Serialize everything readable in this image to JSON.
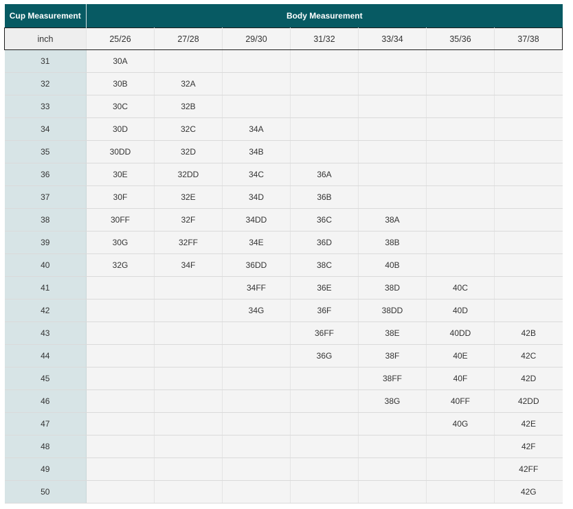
{
  "header": {
    "cup_measurement": "Cup Measurement",
    "body_measurement": "Body Measurement"
  },
  "subheader": {
    "unit": "inch",
    "body_sizes": [
      "25/26",
      "27/28",
      "29/30",
      "31/32",
      "33/34",
      "35/36",
      "37/38"
    ]
  },
  "rows": [
    {
      "cup": "31",
      "sizes": [
        "30A",
        "",
        "",
        "",
        "",
        "",
        ""
      ]
    },
    {
      "cup": "32",
      "sizes": [
        "30B",
        "32A",
        "",
        "",
        "",
        "",
        ""
      ]
    },
    {
      "cup": "33",
      "sizes": [
        "30C",
        "32B",
        "",
        "",
        "",
        "",
        ""
      ]
    },
    {
      "cup": "34",
      "sizes": [
        "30D",
        "32C",
        "34A",
        "",
        "",
        "",
        ""
      ]
    },
    {
      "cup": "35",
      "sizes": [
        "30DD",
        "32D",
        "34B",
        "",
        "",
        "",
        ""
      ]
    },
    {
      "cup": "36",
      "sizes": [
        "30E",
        "32DD",
        "34C",
        "36A",
        "",
        "",
        ""
      ]
    },
    {
      "cup": "37",
      "sizes": [
        "30F",
        "32E",
        "34D",
        "36B",
        "",
        "",
        ""
      ]
    },
    {
      "cup": "38",
      "sizes": [
        "30FF",
        "32F",
        "34DD",
        "36C",
        "38A",
        "",
        ""
      ]
    },
    {
      "cup": "39",
      "sizes": [
        "30G",
        "32FF",
        "34E",
        "36D",
        "38B",
        "",
        ""
      ]
    },
    {
      "cup": "40",
      "sizes": [
        "32G",
        "34F",
        "36DD",
        "38C",
        "40B",
        "",
        ""
      ]
    },
    {
      "cup": "41",
      "sizes": [
        "",
        "",
        "34FF",
        "36E",
        "38D",
        "40C",
        ""
      ]
    },
    {
      "cup": "42",
      "sizes": [
        "",
        "",
        "34G",
        "36F",
        "38DD",
        "40D",
        ""
      ]
    },
    {
      "cup": "43",
      "sizes": [
        "",
        "",
        "",
        "36FF",
        "38E",
        "40DD",
        "42B"
      ]
    },
    {
      "cup": "44",
      "sizes": [
        "",
        "",
        "",
        "36G",
        "38F",
        "40E",
        "42C"
      ]
    },
    {
      "cup": "45",
      "sizes": [
        "",
        "",
        "",
        "",
        "38FF",
        "40F",
        "42D"
      ]
    },
    {
      "cup": "46",
      "sizes": [
        "",
        "",
        "",
        "",
        "38G",
        "40FF",
        "42DD"
      ]
    },
    {
      "cup": "47",
      "sizes": [
        "",
        "",
        "",
        "",
        "",
        "40G",
        "42E"
      ]
    },
    {
      "cup": "48",
      "sizes": [
        "",
        "",
        "",
        "",
        "",
        "",
        "42F"
      ]
    },
    {
      "cup": "49",
      "sizes": [
        "",
        "",
        "",
        "",
        "",
        "",
        "42FF"
      ]
    },
    {
      "cup": "50",
      "sizes": [
        "",
        "",
        "",
        "",
        "",
        "",
        "42G"
      ]
    }
  ],
  "colors": {
    "header_bg": "#075a63",
    "first_column_bg": "#d7e4e6",
    "cell_bg": "#f4f4f4"
  }
}
